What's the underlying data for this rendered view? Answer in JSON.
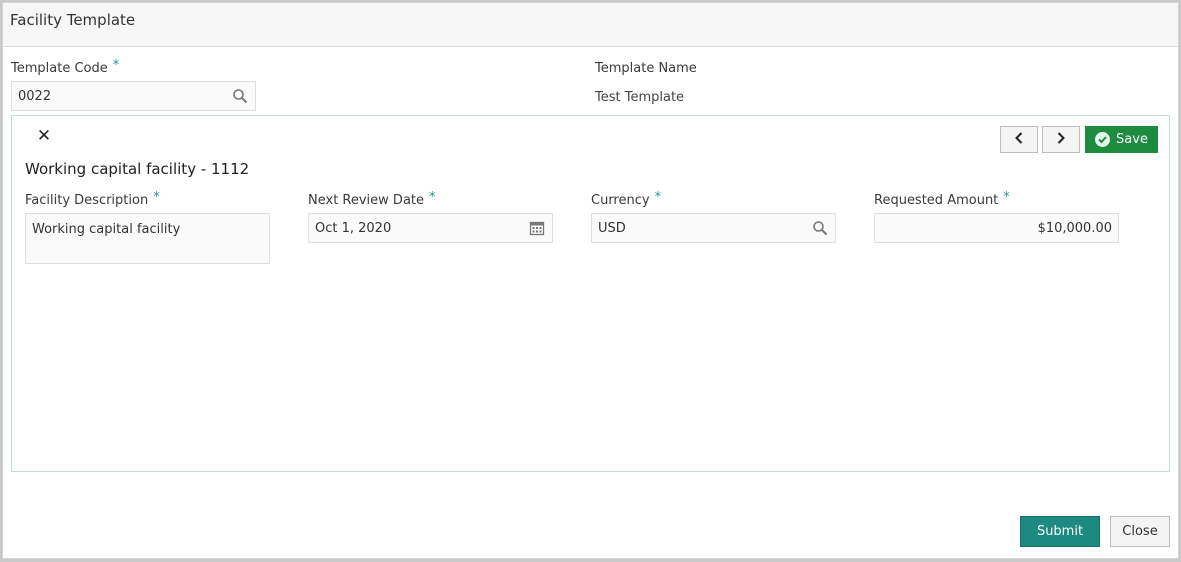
{
  "window": {
    "title": "Facility Template"
  },
  "template_code": {
    "label": "Template Code",
    "required_mark": "*",
    "value": "0022",
    "icon": "search-icon"
  },
  "template_name": {
    "label": "Template Name",
    "value": "Test Template"
  },
  "panel": {
    "title": "Working capital facility - 1112",
    "close_icon": "close-icon",
    "prev_icon": "chevron-left-icon",
    "next_icon": "chevron-right-icon",
    "save_label": "Save",
    "fields": {
      "facility_description": {
        "label": "Facility Description",
        "required_mark": "*",
        "value": "Working capital facility"
      },
      "next_review_date": {
        "label": "Next Review Date",
        "required_mark": "*",
        "value": "Oct 1, 2020",
        "icon": "calendar-icon"
      },
      "currency": {
        "label": "Currency",
        "required_mark": "*",
        "value": "USD",
        "icon": "search-icon"
      },
      "requested_amount": {
        "label": "Requested Amount",
        "required_mark": "*",
        "value": "$10,000.00"
      }
    }
  },
  "footer": {
    "submit_label": "Submit",
    "close_label": "Close"
  },
  "colors": {
    "accent": "#1c8a80",
    "save_green": "#1d8c3f",
    "required_mark": "#1f9a8c",
    "panel_border": "#bfe0dc"
  }
}
